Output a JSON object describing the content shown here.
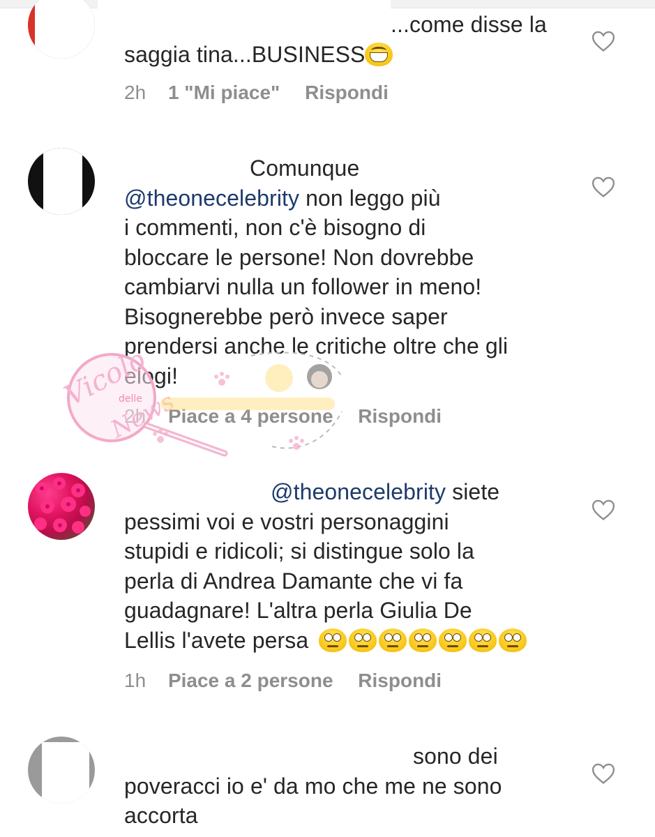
{
  "comments": [
    {
      "username": "",
      "text_lines": [
        "...come disse la",
        "saggia tina...BUSINESS"
      ],
      "emoji": "grin-emoji",
      "time": "2h",
      "likes": "1 \"Mi piace\"",
      "reply": "Rispondi"
    },
    {
      "lead": "Comunque",
      "mention": "@theonecelebrity",
      "text_after_mention": " non leggo più",
      "text_lines": [
        "i commenti, non c'è bisogno di",
        "bloccare le persone! Non dovrebbe",
        "cambiarvi nulla un follower in meno!",
        "Bisognerebbe però invece saper",
        "prendersi anche le critiche oltre che gli",
        "elogi!"
      ],
      "time": "2h",
      "likes": "Piace a 4 persone",
      "reply": "Rispondi"
    },
    {
      "mention": "@theonecelebrity",
      "text_after_mention": " siete",
      "text_lines": [
        "pessimi voi e vostri personaggini",
        "stupidi e ridicoli; si distingue solo la",
        "perla di Andrea Damante che vi fa",
        "guadagnare! L'altra perla Giulia De",
        "Lellis l'avete persa"
      ],
      "emoji_count": 7,
      "emoji": "eye-roll-emoji",
      "time": "1h",
      "likes": "Piace a 2 persone",
      "reply": "Rispondi"
    },
    {
      "first_line_visible": "sono dei",
      "text_lines": [
        "poveracci io e' da mo che me ne sono",
        "accorta"
      ]
    }
  ],
  "watermark": {
    "text_main": "Vicolo",
    "text_small": "delle",
    "text_tail": "News"
  },
  "colors": {
    "text": "#262626",
    "meta": "#8e8e8e",
    "mention": "#1d3a6b",
    "heart_outline": "#8e8e8e"
  },
  "icons": {
    "like": "heart-outline-icon"
  }
}
